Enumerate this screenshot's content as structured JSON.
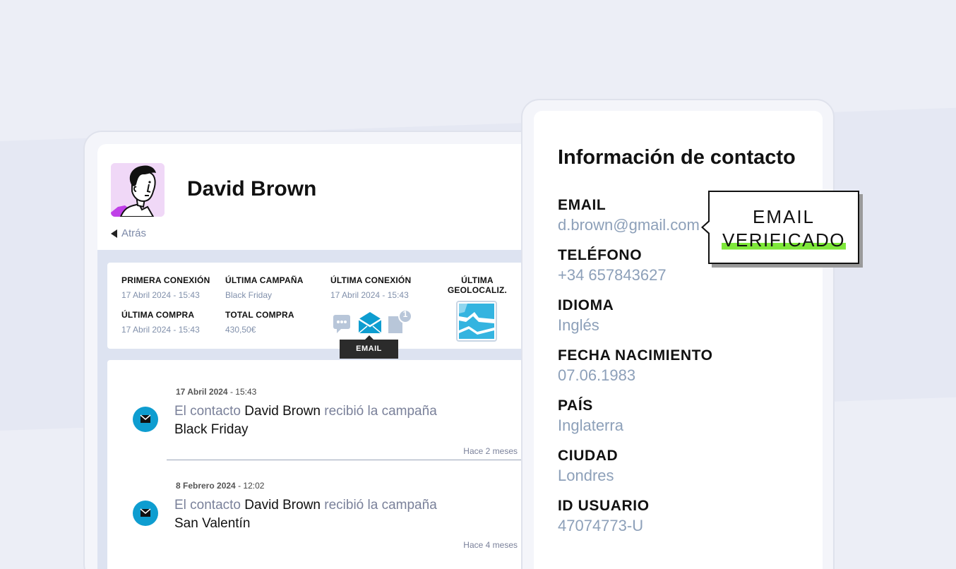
{
  "profile": {
    "name": "David Brown",
    "back_label": "Atrás"
  },
  "stats": {
    "first_connection": {
      "label": "PRIMERA CONEXIÓN",
      "value": "17 Abril 2024 - 15:43"
    },
    "last_campaign": {
      "label": "ÚLTIMA CAMPAÑA",
      "value": "Black Friday"
    },
    "last_connection": {
      "label": "ÚLTIMA CONEXIÓN",
      "value": "17 Abril 2024 - 15:43"
    },
    "last_geo": {
      "label_line1": "ÚLTIMA",
      "label_line2": "GEOLOCALIZ."
    },
    "last_purchase": {
      "label": "ÚLTIMA COMPRA",
      "value": "17 Abril 2024 - 15:43"
    },
    "total_purchase": {
      "label": "TOTAL COMPRA",
      "value": "430,50€"
    },
    "channels": {
      "selected_tooltip": "EMAIL",
      "notification_count": "1",
      "icons": [
        "chat-icon",
        "email-icon",
        "document-icon"
      ]
    }
  },
  "timeline": [
    {
      "date": "17 Abril 2024",
      "time": "- 15:43",
      "prefix": "El contacto",
      "contact": "David Brown",
      "suffix": "recibió la campaña",
      "campaign": "Black Friday",
      "ago": "Hace 2 meses"
    },
    {
      "date": "8 Febrero 2024",
      "time": "- 12:02",
      "prefix": "El contacto",
      "contact": "David Brown",
      "suffix": "recibió la campaña",
      "campaign": "San Valentín",
      "ago": "Hace 4 meses"
    }
  ],
  "contact_info": {
    "title": "Información de contacto",
    "fields": [
      {
        "label": "EMAIL",
        "value": "d.brown@gmail.com"
      },
      {
        "label": "TELÉFONO",
        "value": "+34 657843627"
      },
      {
        "label": "IDIOMA",
        "value": "Inglés"
      },
      {
        "label": "FECHA NACIMIENTO",
        "value": "07.06.1983"
      },
      {
        "label": "PAÍS",
        "value": "Inglaterra"
      },
      {
        "label": "CIUDAD",
        "value": "Londres"
      },
      {
        "label": "ID USUARIO",
        "value": "47074773-U"
      }
    ]
  },
  "callout": {
    "line1": "EMAIL",
    "line2": "VERIFICADO",
    "highlight_color": "#7ee83a"
  },
  "colors": {
    "accent": "#0e9dd0",
    "muted_text": "#8da0b9"
  }
}
